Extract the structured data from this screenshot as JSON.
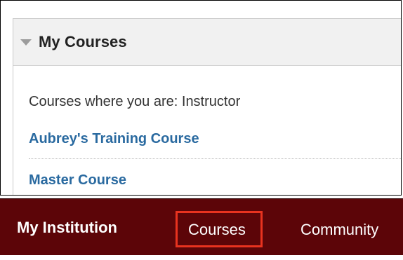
{
  "module": {
    "title": "My Courses",
    "role_text": "Courses where you are: Instructor",
    "courses": [
      {
        "label": "Aubrey's Training Course"
      },
      {
        "label": "Master Course"
      }
    ]
  },
  "nav": {
    "items": [
      {
        "label": "My Institution"
      },
      {
        "label": "Courses"
      },
      {
        "label": "Community"
      }
    ],
    "highlight_color": "#e8331f",
    "bar_color": "#5c0508"
  }
}
